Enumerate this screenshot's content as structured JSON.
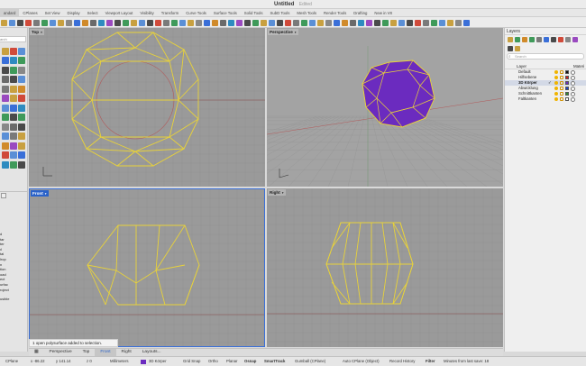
{
  "window": {
    "title": "Untitled",
    "status": "Edited"
  },
  "tabs": [
    {
      "label": "andard",
      "active": true
    },
    {
      "label": "CPlanes"
    },
    {
      "label": "Set View"
    },
    {
      "label": "Display"
    },
    {
      "label": "Select"
    },
    {
      "label": "Viewport Layout"
    },
    {
      "label": "Visibility"
    },
    {
      "label": "Transform"
    },
    {
      "label": "Curve Tools"
    },
    {
      "label": "Surface Tools"
    },
    {
      "label": "Solid Tools"
    },
    {
      "label": "SubD Tools"
    },
    {
      "label": "Mesh Tools"
    },
    {
      "label": "Render Tools"
    },
    {
      "label": "Drafting"
    },
    {
      "label": "New in V8"
    }
  ],
  "left_panel": {
    "search_placeholder": "arch",
    "commands": [
      "d",
      "tar",
      "ter",
      "ıl",
      "tal",
      "lrop",
      "n",
      "tion",
      "oad",
      "ect",
      "urfac",
      "roject",
      "usible"
    ]
  },
  "viewports": {
    "top": {
      "label": "Top"
    },
    "perspective": {
      "label": "Perspective"
    },
    "front": {
      "label": "Front"
    },
    "right": {
      "label": "Right"
    }
  },
  "toast": "1 open polysurface added to selection.",
  "viewport_tabs": [
    "Perspective",
    "Top",
    "Front",
    "Right",
    "Layouts..."
  ],
  "layers_panel": {
    "title": "Layers",
    "search_placeholder": "Search",
    "col_layer": "Layer",
    "col_material": "Materi",
    "layers": [
      {
        "name": "Default",
        "color": "#111111"
      },
      {
        "name": "Hilfsebene",
        "color": "#d81b1b"
      },
      {
        "name": "3D Körper",
        "color": "#6b2bbf",
        "current": true
      },
      {
        "name": "Abwicklung",
        "color": "#1a3fcf"
      },
      {
        "name": "Schnittkanten",
        "color": "#2e8b2e"
      },
      {
        "name": "Faltkanten",
        "color": "#ffffff"
      }
    ]
  },
  "status_bar": {
    "cplane": "CPlane",
    "x": "x -86.22",
    "y": "y 141.14",
    "z": "z 0",
    "units": "Millimeters",
    "layer": "3D Körper",
    "grid_snap": "Grid Snap",
    "ortho": "Ortho",
    "planar": "Planar",
    "osnap": "Osnap",
    "smarttrack": "SmartTrack",
    "gumball": "Gumball (CPlane)",
    "auto_cplane": "Auto CPlane (Object)",
    "record_history": "Record History",
    "filter": "Filter",
    "save_info": "Minutes from last save: 18"
  },
  "colors": {
    "wire": "#e8d23a",
    "accent": "#2a62c9",
    "solid": "#6b2bbf"
  }
}
